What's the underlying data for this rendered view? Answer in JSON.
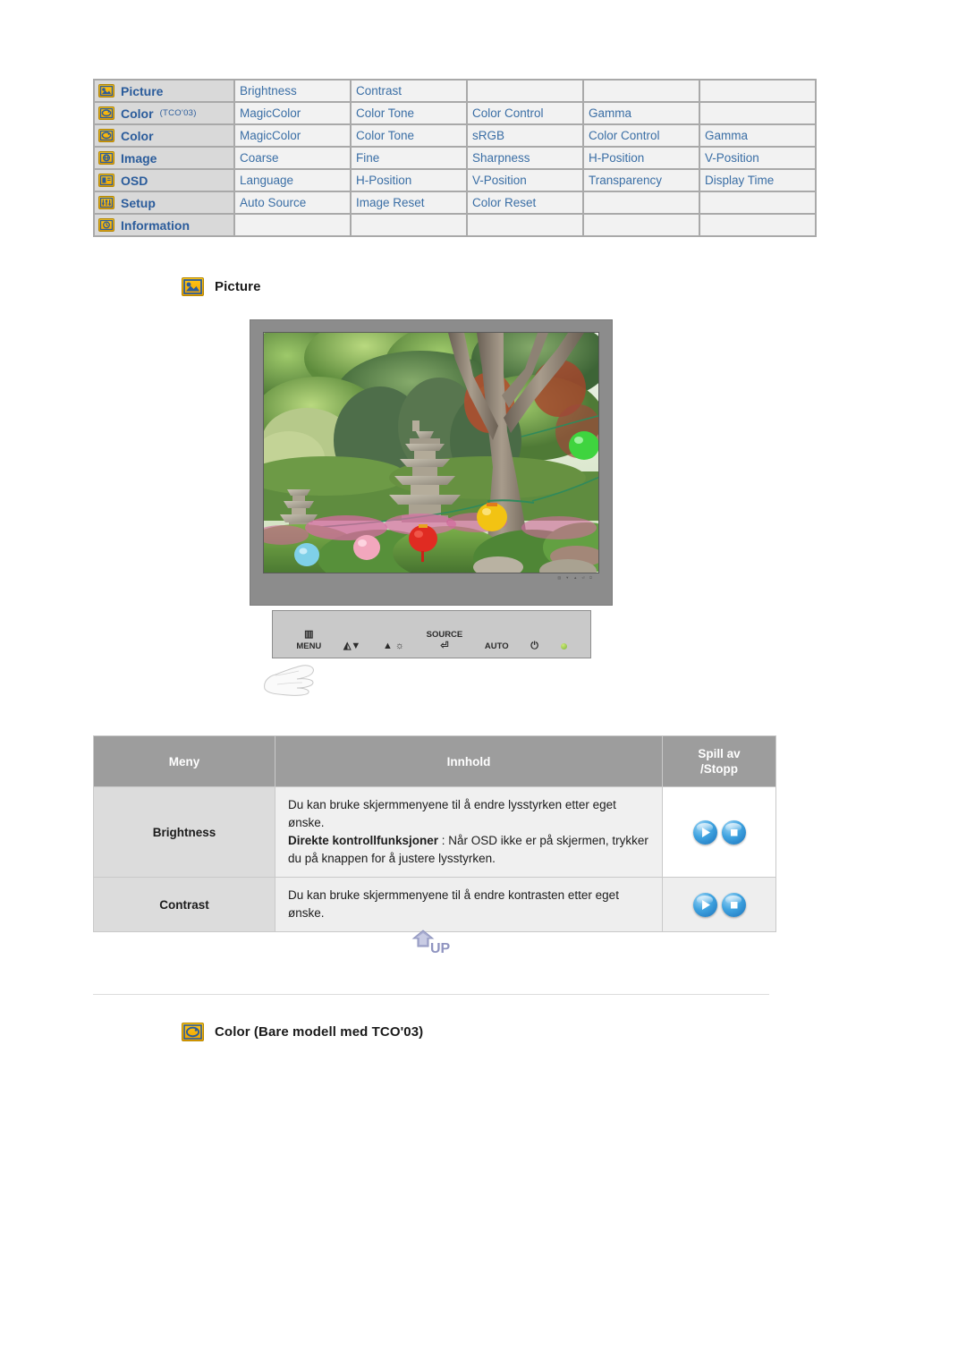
{
  "nav_table": {
    "rows": [
      {
        "icon": "picture-icon",
        "label": "Picture",
        "suffix": "",
        "items": [
          "Brightness",
          "Contrast",
          "",
          "",
          ""
        ]
      },
      {
        "icon": "palette-icon",
        "label": "Color",
        "suffix": "(TCO'03)",
        "items": [
          "MagicColor",
          "Color Tone",
          "Color Control",
          "Gamma",
          ""
        ]
      },
      {
        "icon": "palette-icon",
        "label": "Color",
        "suffix": "",
        "items": [
          "MagicColor",
          "Color Tone",
          "sRGB",
          "Color Control",
          "Gamma"
        ]
      },
      {
        "icon": "image-globe-icon",
        "label": "Image",
        "suffix": "",
        "items": [
          "Coarse",
          "Fine",
          "Sharpness",
          "H-Position",
          "V-Position"
        ]
      },
      {
        "icon": "osd-icon",
        "label": "OSD",
        "suffix": "",
        "items": [
          "Language",
          "H-Position",
          "V-Position",
          "Transparency",
          "Display Time"
        ]
      },
      {
        "icon": "sliders-icon",
        "label": "Setup",
        "suffix": "",
        "items": [
          "Auto Source",
          "Image Reset",
          "Color Reset",
          "",
          ""
        ]
      },
      {
        "icon": "clock-info-icon",
        "label": "Information",
        "suffix": "",
        "items": [
          "",
          "",
          "",
          "",
          ""
        ]
      }
    ]
  },
  "picture_section": {
    "icon": "picture-icon",
    "title": "Picture"
  },
  "monitor": {
    "controls": [
      {
        "name": "menu-button",
        "glyph": "▥",
        "label": "MENU"
      },
      {
        "name": "down-button",
        "glyph": "▼",
        "label": ""
      },
      {
        "name": "up-brightness-button",
        "glyph": "▲ ☀",
        "label": ""
      },
      {
        "name": "source-enter-button",
        "glyph": "⏎",
        "label": "SOURCE"
      },
      {
        "name": "auto-button",
        "glyph": "",
        "label": "AUTO"
      },
      {
        "name": "power-button",
        "glyph": "⏻",
        "label": ""
      },
      {
        "name": "power-led",
        "glyph": "",
        "label": ""
      }
    ]
  },
  "content_table": {
    "headers": {
      "meny": "Meny",
      "innhold": "Innhold",
      "play_stop_line1": "Spill av",
      "play_stop_line2": "/Stopp"
    },
    "rows": [
      {
        "meny": "Brightness",
        "text_lines": [
          {
            "type": "plain",
            "text": "Du kan bruke skjermmenyene til å endre lysstyrken etter eget ønske."
          },
          {
            "type": "bold_lead",
            "bold": "Direkte kontrollfunksjoner",
            "text": " : Når OSD ikke er på skjermen, trykker du på knappen for å justere lysstyrken."
          }
        ],
        "play_icon": "play-icon",
        "stop_icon": "stop-icon"
      },
      {
        "meny": "Contrast",
        "text_lines": [
          {
            "type": "plain",
            "text": "Du kan bruke skjermmenyene til å endre kontrasten etter eget ønske."
          }
        ],
        "play_icon": "play-icon",
        "stop_icon": "stop-icon"
      }
    ]
  },
  "up_button": {
    "label": "UP",
    "icon": "up-arrow-icon"
  },
  "color_section": {
    "icon": "palette-icon",
    "title": "Color (Bare modell med TCO'03)"
  },
  "colors": {
    "nav_link": "#3a6ea5",
    "nav_category": "#2b5c9b",
    "nav_category_bg": "#d9d9d9",
    "nav_cell_bg": "#f2f2f2",
    "table_header_bg": "#9d9d9d",
    "icon_gold": "#f5b000",
    "button_blue": "#1b72bb",
    "led_green": "#8ec63f"
  }
}
